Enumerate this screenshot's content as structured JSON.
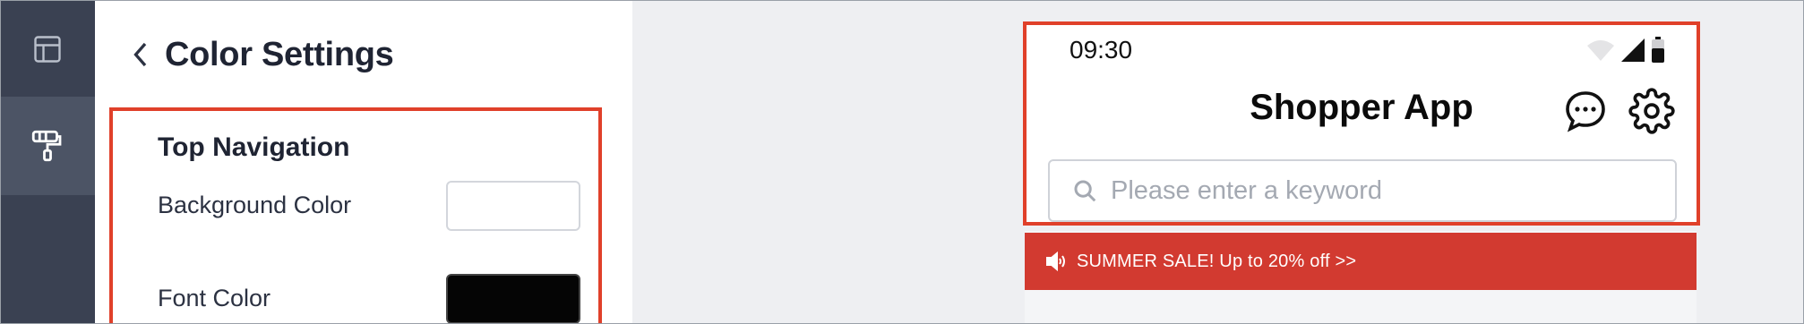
{
  "sidebar": {
    "items": [
      {
        "icon": "layout-icon",
        "active": false
      },
      {
        "icon": "paint-roller-icon",
        "active": true
      }
    ]
  },
  "panel": {
    "title": "Color Settings",
    "section": {
      "title": "Top Navigation",
      "rows": [
        {
          "label": "Background Color",
          "color": "#ffffff"
        },
        {
          "label": "Font Color",
          "color": "#050505"
        }
      ]
    }
  },
  "preview": {
    "status_time": "09:30",
    "app_title": "Shopper App",
    "search_placeholder": "Please enter a keyword",
    "banner_text": "SUMMER SALE! Up to 20% off >>"
  },
  "colors": {
    "accent_outline": "#e0402a",
    "banner": "#d23a30",
    "rail": "#3a4152"
  }
}
